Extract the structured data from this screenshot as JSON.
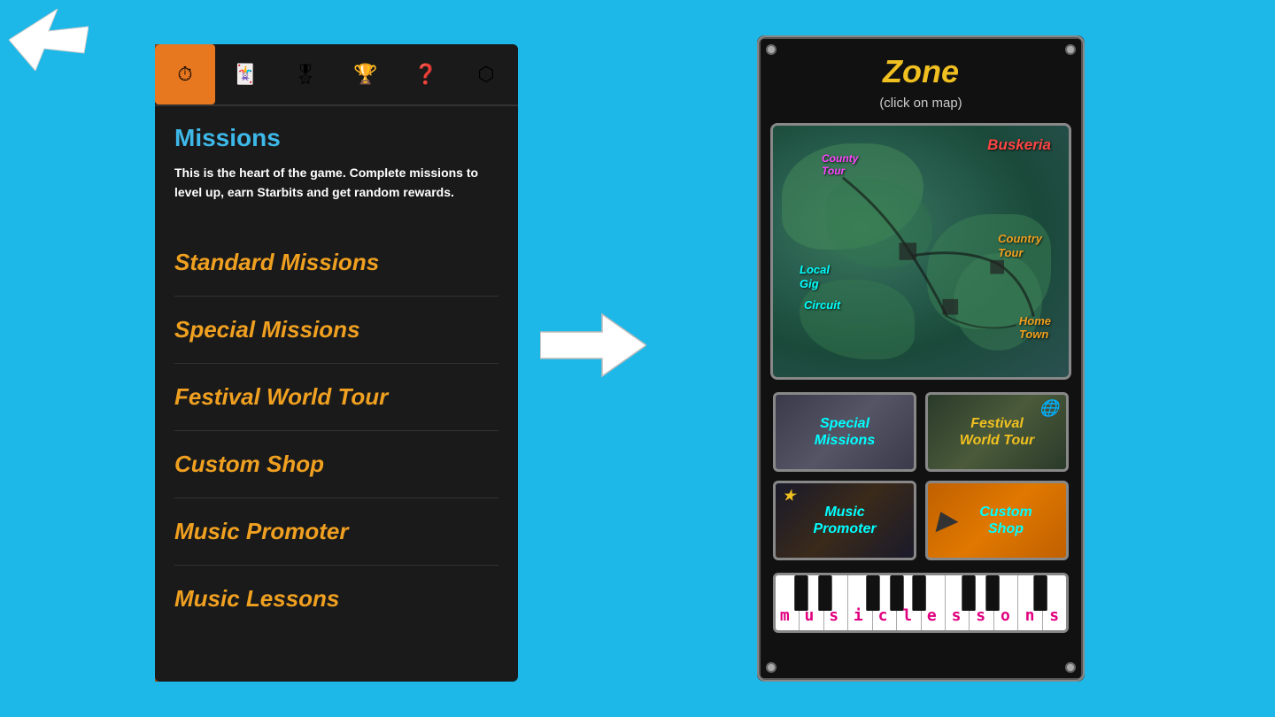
{
  "background_color": "#1db8e8",
  "top_arrow": {
    "label": "pointer arrow"
  },
  "left_panel": {
    "tabs": [
      {
        "icon": "⏱",
        "label": "missions-tab",
        "active": true
      },
      {
        "icon": "🃏",
        "label": "cards-tab",
        "active": false
      },
      {
        "icon": "🎖",
        "label": "medal-tab",
        "active": false
      },
      {
        "icon": "🏆",
        "label": "trophy-tab",
        "active": false
      },
      {
        "icon": "❓",
        "label": "help-tab",
        "active": false
      },
      {
        "icon": "⬡",
        "label": "hive-tab",
        "active": false
      }
    ],
    "title": "Missions",
    "description": "This is the heart of the game. Complete missions to level up, earn Starbits and get random rewards.",
    "menu_items": [
      {
        "label": "Standard Missions",
        "id": "standard-missions"
      },
      {
        "label": "Special Missions",
        "id": "special-missions"
      },
      {
        "label": "Festival World Tour",
        "id": "festival-world-tour"
      },
      {
        "label": "Custom Shop",
        "id": "custom-shop"
      },
      {
        "label": "Music Promoter",
        "id": "music-promoter"
      },
      {
        "label": "Music Lessons",
        "id": "music-lessons"
      }
    ]
  },
  "center_arrow": {
    "label": "navigation arrow"
  },
  "right_panel": {
    "zone_title": "Zone",
    "zone_subtitle": "(click on map)",
    "map": {
      "labels": [
        {
          "text": "Buskeria",
          "class": "buskeria"
        },
        {
          "text": "County\nTour",
          "class": "county-tour-top"
        },
        {
          "text": "Country\nTour",
          "class": "country-tour"
        },
        {
          "text": "Local\nGig",
          "class": "local-gig"
        },
        {
          "text": "Circuit",
          "class": "circuit"
        },
        {
          "text": "Home\nTown",
          "class": "hometown"
        }
      ]
    },
    "buttons": [
      {
        "label": "Special\nMissions",
        "class": "special",
        "id": "special-missions-btn"
      },
      {
        "label": "Festival\nWorld Tour",
        "class": "festival",
        "id": "festival-btn"
      },
      {
        "label": "Music\nPromoter",
        "class": "music-promoter",
        "id": "music-promoter-btn"
      },
      {
        "label": "Custom\nShop",
        "class": "custom-shop",
        "id": "custom-shop-btn"
      }
    ],
    "music_lessons": {
      "label": "m u s i c  l e s s o n s"
    }
  }
}
